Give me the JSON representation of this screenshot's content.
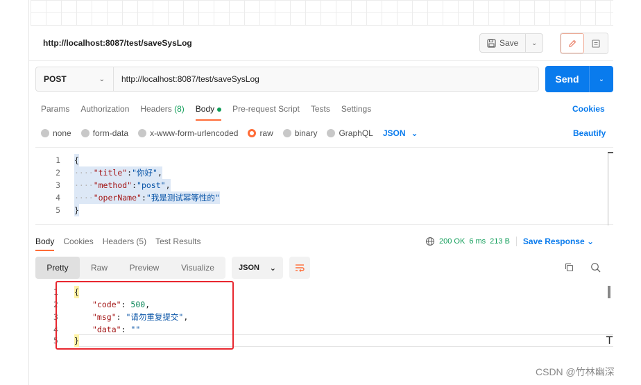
{
  "request": {
    "title": "http://localhost:8087/test/saveSysLog",
    "save_label": "Save",
    "method": "POST",
    "url": "http://localhost:8087/test/saveSysLog",
    "send_label": "Send"
  },
  "request_tabs": [
    {
      "label": "Params"
    },
    {
      "label": "Authorization"
    },
    {
      "label": "Headers",
      "count": "(8)"
    },
    {
      "label": "Body"
    },
    {
      "label": "Pre-request Script"
    },
    {
      "label": "Tests"
    },
    {
      "label": "Settings"
    }
  ],
  "cookies_label": "Cookies",
  "body_types": {
    "none": "none",
    "form_data": "form-data",
    "urlencoded": "x-www-form-urlencoded",
    "raw": "raw",
    "binary": "binary",
    "graphql": "GraphQL",
    "format": "JSON"
  },
  "beautify_label": "Beautify",
  "request_body": {
    "line_numbers": [
      "1",
      "2",
      "3",
      "4",
      "5"
    ],
    "open": "{",
    "indent": "····",
    "k1": "\"title\"",
    "v1": "\"你好\"",
    "k2": "\"method\"",
    "v2": "\"post\"",
    "k3": "\"operName\"",
    "v3": "\"我是测试幂等性的\"",
    "close": "}"
  },
  "response_tabs": [
    {
      "label": "Body"
    },
    {
      "label": "Cookies"
    },
    {
      "label": "Headers",
      "count": "(5)"
    },
    {
      "label": "Test Results"
    }
  ],
  "response_status": {
    "status": "200 OK",
    "time": "6 ms",
    "size": "213 B",
    "save_response": "Save Response"
  },
  "view_modes": [
    "Pretty",
    "Raw",
    "Preview",
    "Visualize"
  ],
  "response_format": "JSON",
  "response_body": {
    "open": "{",
    "k1": "\"code\"",
    "v1": "500",
    "k2": "\"msg\"",
    "v2": "\"请勿重复提交\"",
    "k3": "\"data\"",
    "v3": "\"\"",
    "close": "}"
  },
  "watermark": "CSDN @竹林幽深",
  "colors": {
    "accent": "#ff6c37",
    "send": "#097bed",
    "ok": "#0f9d58",
    "highlight_box": "#e8272f"
  }
}
